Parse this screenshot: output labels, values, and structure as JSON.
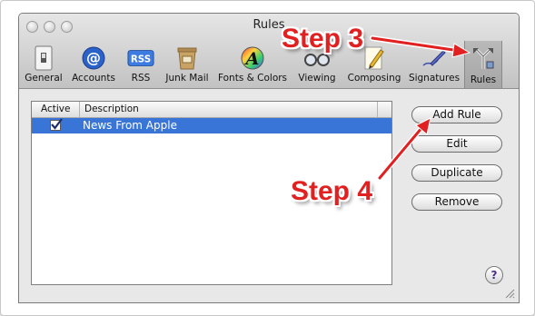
{
  "window": {
    "title": "Rules"
  },
  "toolbar": {
    "items": [
      {
        "label": "General",
        "icon": "switch-icon"
      },
      {
        "label": "Accounts",
        "icon": "at-icon"
      },
      {
        "label": "RSS",
        "icon": "rss-icon"
      },
      {
        "label": "Junk Mail",
        "icon": "junk-mail-icon"
      },
      {
        "label": "Fonts & Colors",
        "icon": "fonts-colors-icon"
      },
      {
        "label": "Viewing",
        "icon": "glasses-icon"
      },
      {
        "label": "Composing",
        "icon": "pencil-icon"
      },
      {
        "label": "Signatures",
        "icon": "signature-pen-icon"
      },
      {
        "label": "Rules",
        "icon": "rules-arrows-icon"
      }
    ],
    "selected": "Rules"
  },
  "rules_table": {
    "columns": [
      "Active",
      "Description"
    ],
    "rows": [
      {
        "active": true,
        "description": "News From Apple"
      }
    ]
  },
  "buttons": {
    "add_rule": "Add Rule",
    "edit": "Edit",
    "duplicate": "Duplicate",
    "remove": "Remove",
    "help": "?"
  },
  "annotations": {
    "step3": "Step 3",
    "step4": "Step 4"
  },
  "colors": {
    "annotation_red": "#e12121",
    "selection_blue": "#3875d7"
  }
}
